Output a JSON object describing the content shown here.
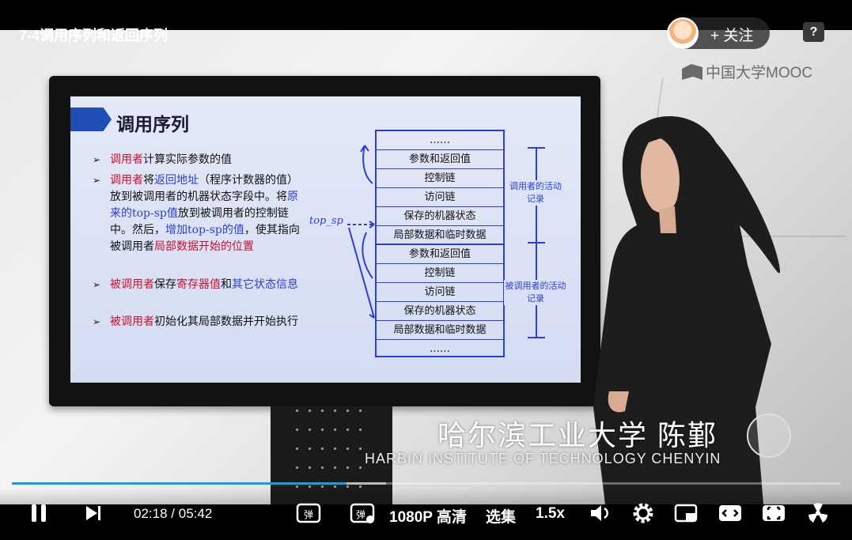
{
  "header": {
    "video_title": "7-4调用序列和返回序列",
    "follow_label": "+ 关注",
    "help_label": "?",
    "platform_logo": "中国大学MOOC"
  },
  "slide": {
    "title": "调用序列",
    "bullets": [
      {
        "marker": "➢",
        "parts": [
          [
            "red",
            "调用者"
          ],
          [
            "",
            "计算实际参数的值"
          ]
        ]
      },
      {
        "marker": "➢",
        "parts": [
          [
            "red",
            "调用者"
          ],
          [
            "",
            "将"
          ],
          [
            "blue",
            "返回地址"
          ],
          [
            "",
            "（程序计数器的值）放到被调用者的机器状态字段中。将"
          ],
          [
            "blue",
            "原来的top-sp值"
          ],
          [
            "",
            "放到被调用者的控制链中。然后，"
          ],
          [
            "blue",
            "增加top-sp的值"
          ],
          [
            "",
            "，使其指向被调用者"
          ],
          [
            "red",
            "局部数据开始的位置"
          ]
        ]
      },
      {
        "marker": "➢",
        "parts": [
          [
            "red",
            "被调用者"
          ],
          [
            "",
            "保存"
          ],
          [
            "red",
            "寄存器值"
          ],
          [
            "",
            "和"
          ],
          [
            "blue",
            "其它状态信息"
          ]
        ]
      },
      {
        "marker": "➢",
        "parts": [
          [
            "red",
            "被调用者"
          ],
          [
            "",
            "初始化其局部数据并开始执行"
          ]
        ]
      }
    ],
    "stack_cells": [
      "……",
      "参数和返回值",
      "控制链",
      "访问链",
      "保存的机器状态",
      "局部数据和临时数据",
      "参数和返回值",
      "控制链",
      "访问链",
      "保存的机器状态",
      "局部数据和临时数据",
      "……"
    ],
    "top_sp_label": "top_sp",
    "caller_record_label": "调用者的活动记录",
    "callee_record_label": "被调用者的活动记录"
  },
  "caption": {
    "chinese": "哈尔滨工业大学 陈鄞",
    "english": "HARBIN INSTITUTE OF TECHNOLOGY  CHENYIN"
  },
  "controls": {
    "current_time": "02:18",
    "separator": "/",
    "duration": "05:42",
    "progress": 0.404,
    "buffered": 0.452,
    "quality_label": "1080P 高清",
    "episodes_label": "选集",
    "speed_label": "1.5x",
    "icons": [
      "pause-icon",
      "next-icon",
      "danmaku-toggle-icon",
      "danmaku-settings-icon",
      "volume-icon",
      "settings-icon",
      "pip-icon",
      "widescreen-icon",
      "fullscreen-icon",
      "radiation-icon"
    ]
  },
  "colors": {
    "progress": "#14a0e0",
    "slide_blue": "#2b3fd1",
    "slide_red": "#c8102e"
  }
}
